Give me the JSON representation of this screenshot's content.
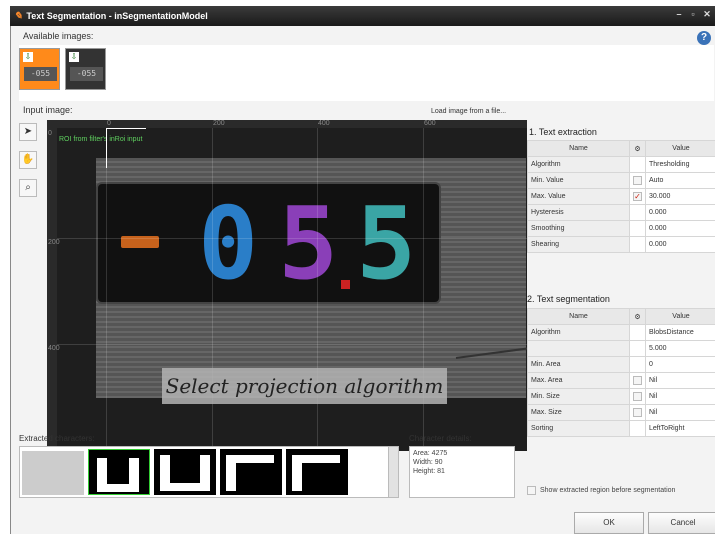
{
  "window": {
    "title": "Text Segmentation - inSegmentationModel"
  },
  "labels": {
    "available_images": "Available images:",
    "input_image": "Input image:",
    "load_image": "Load image from a file...",
    "roi_label": "ROI from filter's inRoi input",
    "extracted_characters": "Extracted characters:",
    "character_details": "Character details:",
    "show_extracted": "Show extracted region before segmentation"
  },
  "thumbnails": [
    {
      "display": "-055",
      "selected": true
    },
    {
      "display": "-055",
      "selected": false
    }
  ],
  "viewer": {
    "ruler_x": [
      "0",
      "200",
      "400",
      "600"
    ],
    "ruler_y": [
      "0",
      "200",
      "400"
    ],
    "display_digits": [
      "0",
      "5",
      "5"
    ],
    "digit_colors": [
      "#2a7ec8",
      "#8a3fb8",
      "#3aa5a5"
    ],
    "caption": "Select projection algorithm"
  },
  "text_extraction": {
    "title": "1. Text extraction",
    "headers": {
      "name": "Name",
      "value": "Value"
    },
    "rows": [
      {
        "name": "Algorithm",
        "value": "Thresholding",
        "check": ""
      },
      {
        "name": "Min. Value",
        "value": "Auto",
        "check": "empty"
      },
      {
        "name": "Max. Value",
        "value": "30.000",
        "check": "checked"
      },
      {
        "name": "Hysteresis",
        "value": "0.000",
        "check": ""
      },
      {
        "name": "Smoothing",
        "value": "0.000",
        "check": ""
      },
      {
        "name": "Shearing",
        "value": "0.000",
        "check": ""
      }
    ]
  },
  "text_segmentation": {
    "title": "2. Text segmentation",
    "headers": {
      "name": "Name",
      "value": "Value"
    },
    "rows": [
      {
        "name": "Algorithm",
        "value": "BlobsDistance",
        "check": ""
      },
      {
        "name": "",
        "value": "5.000",
        "check": ""
      },
      {
        "name": "Min. Area",
        "value": "0",
        "check": ""
      },
      {
        "name": "Max. Area",
        "value": "Nil",
        "check": "empty"
      },
      {
        "name": "Min. Size",
        "value": "Nil",
        "check": "empty"
      },
      {
        "name": "Max. Size",
        "value": "Nil",
        "check": "empty"
      },
      {
        "name": "Sorting",
        "value": "LeftToRight",
        "check": ""
      }
    ]
  },
  "character_details": {
    "area": "Area: 4275",
    "width": "Width: 90",
    "height": "Height: 81"
  },
  "buttons": {
    "ok": "OK",
    "cancel": "Cancel"
  }
}
